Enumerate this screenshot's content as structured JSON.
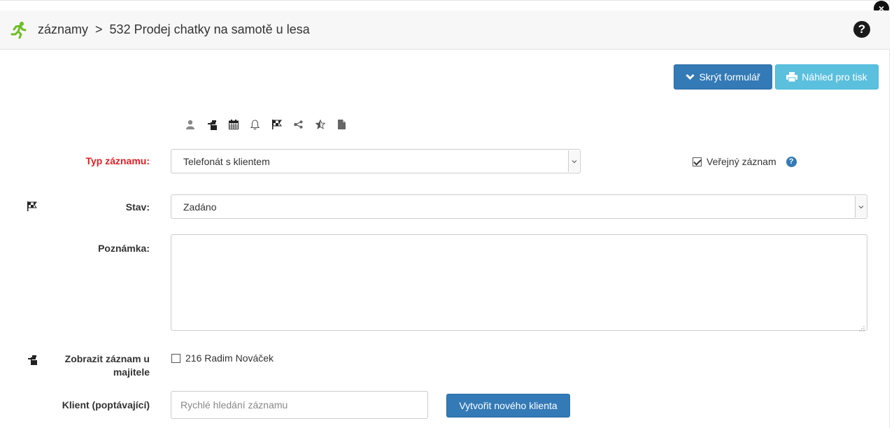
{
  "header": {
    "breadcrumb_root": "záznamy",
    "breadcrumb_sep": ">",
    "breadcrumb_current": "532 Prodej chatky na samotě u lesa",
    "help": "?",
    "close": "×"
  },
  "actions": {
    "hide_form_label": "Skrýt formulář",
    "print_preview_label": "Náhled pro tisk"
  },
  "toolbar": {
    "icons": [
      "user-icon",
      "owner-icon",
      "calendar-icon",
      "bell-icon",
      "flag-icon",
      "share-icon",
      "star-icon",
      "document-icon"
    ]
  },
  "form": {
    "type": {
      "label": "Typ záznamu:",
      "value": "Telefonát s klientem"
    },
    "public": {
      "label": "Veřejný záznam",
      "checked": true,
      "info": "?"
    },
    "state": {
      "label": "Stav:",
      "value": "Zadáno"
    },
    "note": {
      "label": "Poznámka:",
      "value": ""
    },
    "show_owner": {
      "label_line1": "Zobrazit záznam u",
      "label_line2": "majitele",
      "option": "216 Radim Nováček",
      "checked": false
    },
    "client": {
      "label": "Klient (poptávající)",
      "placeholder": "Rychlé hledání záznamu",
      "create_label": "Vytvořit nového klienta"
    }
  },
  "colors": {
    "primary": "#337ab7",
    "info": "#5bc0de",
    "required": "#e31e24",
    "runner": "#6bbf23"
  }
}
